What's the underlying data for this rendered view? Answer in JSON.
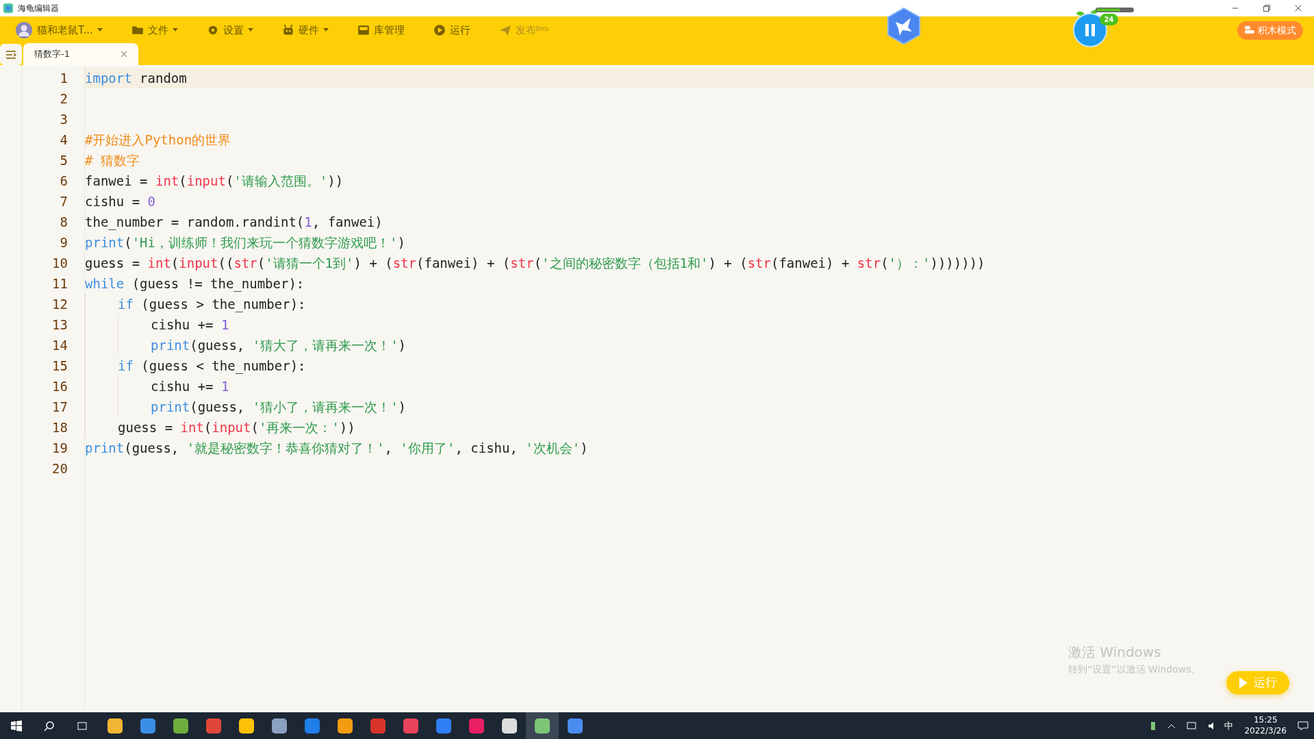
{
  "window": {
    "title": "海龟编辑器"
  },
  "toolbar": {
    "user": "猫和老鼠T...",
    "menus": [
      {
        "label": "文件",
        "has_caret": true,
        "disabled": false
      },
      {
        "label": "设置",
        "has_caret": true,
        "disabled": false
      },
      {
        "label": "硬件",
        "has_caret": true,
        "disabled": false
      },
      {
        "label": "库管理",
        "has_caret": false,
        "disabled": false
      },
      {
        "label": "运行",
        "has_caret": false,
        "disabled": false
      },
      {
        "label": "发布$^{Beta}$",
        "has_caret": false,
        "disabled": true
      }
    ],
    "badge": "24",
    "mode_button": "积木模式"
  },
  "tabs": [
    {
      "label": "猜数字-1",
      "selected": true
    }
  ],
  "editor": {
    "lines": [
      {
        "number": "1",
        "tokens": [
          {
            "kind": "keyword",
            "text": "import"
          },
          {
            "kind": "plain",
            "text": " random"
          }
        ]
      },
      {
        "number": "2"
      },
      {
        "number": "3"
      },
      {
        "number": "4",
        "tokens": [
          {
            "kind": "comment",
            "text": "#开始进入Python的世界"
          }
        ]
      },
      {
        "number": "5",
        "tokens": [
          {
            "kind": "comment",
            "text": "# 猜数字"
          }
        ]
      },
      {
        "number": "6",
        "tokens": [
          {
            "kind": "plain",
            "text": "fanwei = "
          },
          {
            "kind": "builtin",
            "text": "int"
          },
          {
            "kind": "plain",
            "text": "("
          },
          {
            "kind": "builtin",
            "text": "input"
          },
          {
            "kind": "plain",
            "text": "("
          },
          {
            "kind": "string",
            "text": "'请输入范围。'"
          },
          {
            "kind": "plain",
            "text": "))"
          }
        ]
      },
      {
        "number": "7",
        "tokens": [
          {
            "kind": "plain",
            "text": "cishu = "
          },
          {
            "kind": "number",
            "text": "0"
          }
        ]
      },
      {
        "number": "8",
        "tokens": [
          {
            "kind": "plain",
            "text": "the_number = random.randint("
          },
          {
            "kind": "number",
            "text": "1"
          },
          {
            "kind": "plain",
            "text": ", fanwei)"
          }
        ]
      },
      {
        "number": "9",
        "tokens": [
          {
            "kind": "keyword",
            "text": "print"
          },
          {
            "kind": "plain",
            "text": "("
          },
          {
            "kind": "string",
            "text": "'Hi，训练师！我们来玩一个猜数字游戏吧！'"
          },
          {
            "kind": "plain",
            "text": ")"
          }
        ]
      },
      {
        "number": "10",
        "tokens": [
          {
            "kind": "plain",
            "text": "guess = "
          },
          {
            "kind": "builtin",
            "text": "int"
          },
          {
            "kind": "plain",
            "text": "("
          },
          {
            "kind": "builtin",
            "text": "input"
          },
          {
            "kind": "plain",
            "text": "(("
          },
          {
            "kind": "builtin",
            "text": "str"
          },
          {
            "kind": "plain",
            "text": "("
          },
          {
            "kind": "string",
            "text": "'请猜一个1到'"
          },
          {
            "kind": "plain",
            "text": ") + ("
          },
          {
            "kind": "builtin",
            "text": "str"
          },
          {
            "kind": "plain",
            "text": "(fanwei) + ("
          },
          {
            "kind": "builtin",
            "text": "str"
          },
          {
            "kind": "plain",
            "text": "("
          },
          {
            "kind": "string",
            "text": "'之间的秘密数字（包括1和'"
          },
          {
            "kind": "plain",
            "text": ") + ("
          },
          {
            "kind": "builtin",
            "text": "str"
          },
          {
            "kind": "plain",
            "text": "(fanwei) + "
          },
          {
            "kind": "builtin",
            "text": "str"
          },
          {
            "kind": "plain",
            "text": "("
          },
          {
            "kind": "string",
            "text": "'）：'"
          },
          {
            "kind": "plain",
            "text": ")))))))"
          }
        ]
      },
      {
        "number": "11",
        "tokens": [
          {
            "kind": "keyword",
            "text": "while"
          },
          {
            "kind": "plain",
            "text": " (guess != the_number):"
          }
        ],
        "children": [
          {
            "number": "12",
            "tokens": [
              {
                "kind": "keyword",
                "text": "if"
              },
              {
                "kind": "plain",
                "text": " (guess > the_number):"
              }
            ],
            "children": [
              {
                "number": "13",
                "tokens": [
                  {
                    "kind": "plain",
                    "text": "cishu += "
                  },
                  {
                    "kind": "number",
                    "text": "1"
                  }
                ]
              },
              {
                "number": "14",
                "tokens": [
                  {
                    "kind": "keyword",
                    "text": "print"
                  },
                  {
                    "kind": "plain",
                    "text": "(guess, "
                  },
                  {
                    "kind": "string",
                    "text": "'猜大了，请再来一次！'"
                  },
                  {
                    "kind": "plain",
                    "text": ")"
                  }
                ]
              }
            ]
          },
          {
            "number": "15",
            "tokens": [
              {
                "kind": "keyword",
                "text": "if"
              },
              {
                "kind": "plain",
                "text": " (guess < the_number):"
              }
            ],
            "children": [
              {
                "number": "16",
                "tokens": [
                  {
                    "kind": "plain",
                    "text": "cishu += "
                  },
                  {
                    "kind": "number",
                    "text": "1"
                  }
                ]
              },
              {
                "number": "17",
                "tokens": [
                  {
                    "kind": "keyword",
                    "text": "print"
                  },
                  {
                    "kind": "plain",
                    "text": "(guess, "
                  },
                  {
                    "kind": "string",
                    "text": "'猜小了，请再来一次！'"
                  },
                  {
                    "kind": "plain",
                    "text": ")"
                  }
                ]
              }
            ]
          },
          {
            "number": "18",
            "tokens": [
              {
                "kind": "plain",
                "text": "guess = "
              },
              {
                "kind": "builtin",
                "text": "int"
              },
              {
                "kind": "plain",
                "text": "("
              },
              {
                "kind": "builtin",
                "text": "input"
              },
              {
                "kind": "plain",
                "text": "("
              },
              {
                "kind": "string",
                "text": "'再来一次：'"
              },
              {
                "kind": "plain",
                "text": "))"
              }
            ]
          }
        ]
      },
      {
        "number": "19",
        "tokens": [
          {
            "kind": "keyword",
            "text": "print"
          },
          {
            "kind": "plain",
            "text": "(guess, "
          },
          {
            "kind": "string",
            "text": "'就是秘密数字！恭喜你猜对了！'"
          },
          {
            "kind": "plain",
            "text": ", "
          },
          {
            "kind": "string",
            "text": "'你用了'"
          },
          {
            "kind": "plain",
            "text": ", cishu, "
          },
          {
            "kind": "string",
            "text": "'次机会'"
          },
          {
            "kind": "plain",
            "text": ")"
          }
        ]
      },
      {
        "number": "20"
      }
    ]
  },
  "run_button": "运行",
  "activation_notice": {
    "title": "激活 Windows",
    "text": "转到“设置”以激活 Windows。"
  },
  "taskbar": {
    "apps": [
      {
        "color": "#f2b632",
        "selected": false
      },
      {
        "color": "#3a8ee6",
        "selected": false
      },
      {
        "color": "#6fae3c",
        "selected": false
      },
      {
        "color": "#e0463a",
        "selected": false
      },
      {
        "color": "#ffc107",
        "selected": false
      },
      {
        "color": "#8aa1c2",
        "selected": false
      },
      {
        "color": "#1f7ee8",
        "selected": false
      },
      {
        "color": "#f39c12",
        "selected": false
      },
      {
        "color": "#d9342b",
        "selected": false
      },
      {
        "color": "#e8435a",
        "selected": false
      },
      {
        "color": "#2f7ef5",
        "selected": false
      },
      {
        "color": "#e91e63",
        "selected": false
      },
      {
        "color": "#dddddd",
        "selected": false
      },
      {
        "color": "#7cc576",
        "selected": true
      },
      {
        "color": "#4a8df0",
        "selected": false
      }
    ],
    "ime": "中",
    "time": "15:25",
    "date": "2022/3/26"
  }
}
